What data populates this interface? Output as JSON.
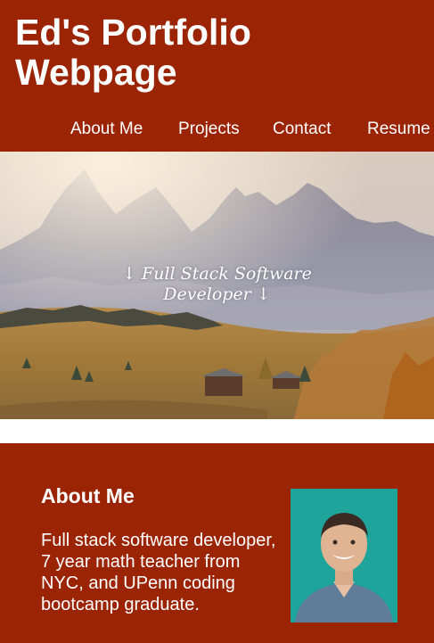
{
  "header": {
    "title": "Ed's Portfolio Webpage",
    "nav": [
      "About Me",
      "Projects",
      "Contact",
      "Resume"
    ]
  },
  "hero": {
    "caption_line1": "↓ Full Stack Software",
    "caption_line2": "Developer ↓"
  },
  "about": {
    "heading": "About Me",
    "text": "Full stack software developer, 7 year math teacher from NYC, and UPenn coding bootcamp graduate."
  },
  "colors": {
    "brand": "#9b2404",
    "text": "#ffffff"
  }
}
